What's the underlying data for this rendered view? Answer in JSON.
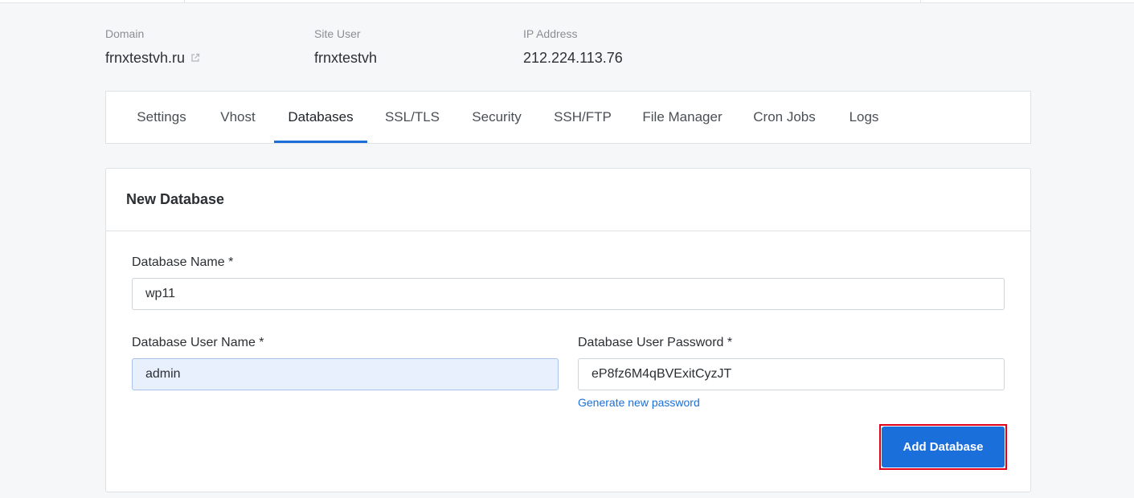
{
  "info": {
    "domain": {
      "label": "Domain",
      "value": "frnxtestvh.ru",
      "icon": "external-link-icon"
    },
    "site_user": {
      "label": "Site User",
      "value": "frnxtestvh"
    },
    "ip_address": {
      "label": "IP Address",
      "value": "212.224.113.76"
    }
  },
  "tabs": [
    {
      "label": "Settings"
    },
    {
      "label": "Vhost"
    },
    {
      "label": "Databases",
      "active": true
    },
    {
      "label": "SSL/TLS"
    },
    {
      "label": "Security"
    },
    {
      "label": "SSH/FTP"
    },
    {
      "label": "File Manager"
    },
    {
      "label": "Cron Jobs"
    },
    {
      "label": "Logs"
    }
  ],
  "form": {
    "title": "New Database",
    "db_name": {
      "label": "Database Name *",
      "value": "wp11"
    },
    "db_user": {
      "label": "Database User Name *",
      "value": "admin"
    },
    "db_password": {
      "label": "Database User Password *",
      "value": "eP8fz6M4qBVExitCyzJT"
    },
    "generate_link": "Generate new password",
    "submit_label": "Add Database"
  },
  "colors": {
    "accent": "#1a6fdb",
    "highlight_frame": "#e2001a",
    "autofill_bg": "#e8f0fe"
  }
}
